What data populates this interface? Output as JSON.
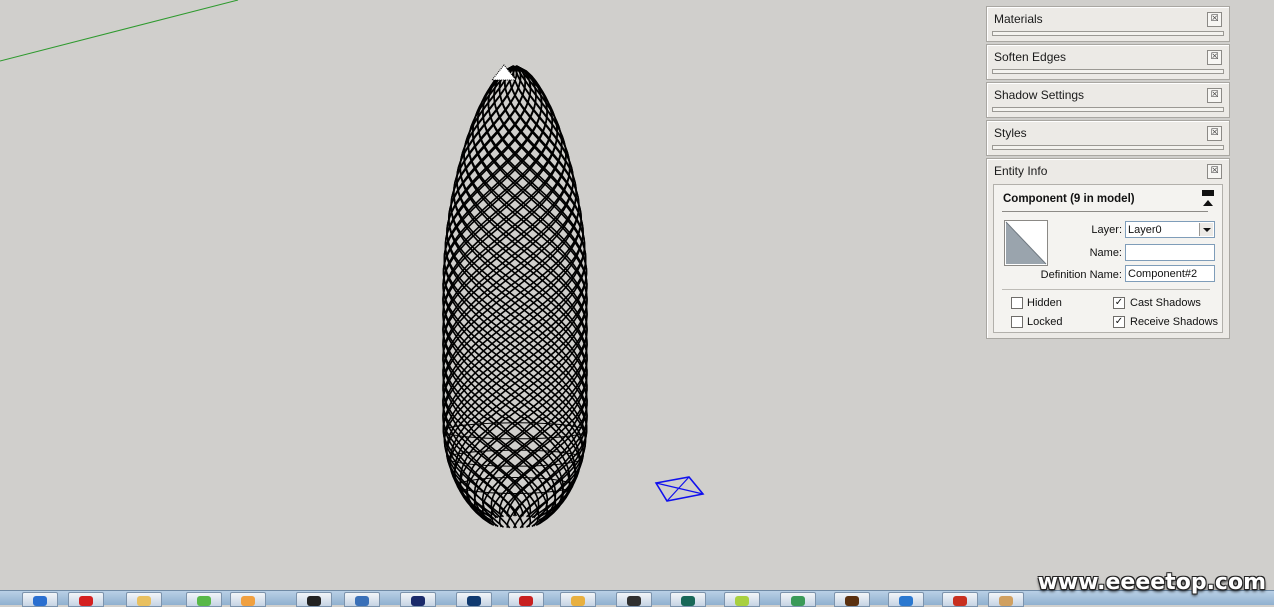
{
  "trays": {
    "materials": {
      "title": "Materials",
      "close": "☒"
    },
    "soften_edges": {
      "title": "Soften Edges",
      "close": "☒"
    },
    "shadow_settings": {
      "title": "Shadow Settings",
      "close": "☒"
    },
    "styles": {
      "title": "Styles",
      "close": "☒"
    },
    "entity_info": {
      "title": "Entity Info",
      "close": "☒"
    }
  },
  "entity": {
    "heading": "Component (9 in model)",
    "layer_label": "Layer:",
    "layer_value": "Layer0",
    "name_label": "Name:",
    "name_value": "",
    "definition_label": "Definition Name:",
    "definition_value": "Component#2",
    "hidden_label": "Hidden",
    "hidden_checked": false,
    "locked_label": "Locked",
    "locked_checked": false,
    "cast_label": "Cast Shadows",
    "cast_checked": true,
    "receive_label": "Receive Shadows",
    "receive_checked": true,
    "check_mark": "✓"
  },
  "colors": {
    "background": "#d0cfcc",
    "lattice": "#000000",
    "axis_green": "#2e9a2e",
    "section_plane": "#1010ee"
  },
  "watermark": "www.eeeetop.com",
  "taskbar": {
    "icons": [
      "start-icon",
      "red-app-icon",
      "folder-icon",
      "green-app-icon",
      "paint-icon",
      "penguin-icon",
      "python-icon",
      "ps-icon",
      "ps2-icon",
      "pdf-icon",
      "folder2-icon",
      "terminal-icon",
      "sketchup-icon",
      "lime-icon",
      "green-gem-icon",
      "ai-icon",
      "ie-icon",
      "acrobat-icon",
      "users-icon"
    ]
  }
}
